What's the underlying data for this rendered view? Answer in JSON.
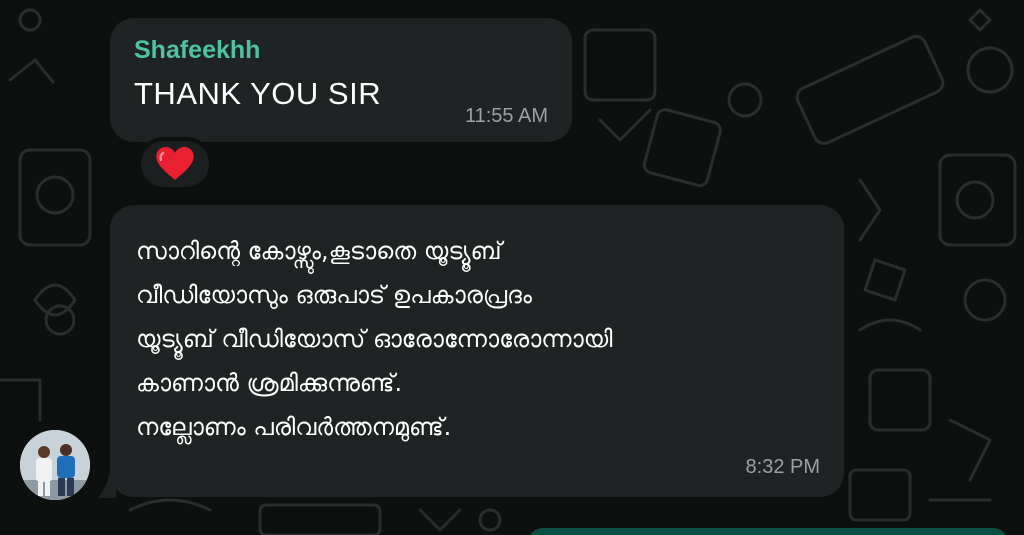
{
  "messages": [
    {
      "sender": "Shafeekhh",
      "text": "THANK YOU SIR",
      "time": "11:55 AM",
      "reaction": "heart-emoji"
    },
    {
      "lines": [
        "സാറിന്റെ കോഴ്സും,കൂടാതെ യൂട്യൂബ്",
        "വീഡിയോസും ഒരുപാട് ഉപകാരപ്രദം",
        "യൂട്യൂബ് വീഡിയോസ് ഓരോന്നോരോന്നായി",
        "കാണാൻ ശ്രമിക്കുന്നുണ്ട്.",
        "നല്ലോണം പരിവർത്തനമുണ്ട്."
      ],
      "time": "8:32 PM"
    }
  ],
  "colors": {
    "background": "#0e0f0f",
    "bubble": "#202324",
    "sender_name": "#4fc3a1",
    "timestamp": "#9aa0a3",
    "outgoing_bubble": "#0b4f45"
  },
  "icons": {
    "reaction": "heart-icon",
    "avatar": "contact-avatar-photo"
  }
}
